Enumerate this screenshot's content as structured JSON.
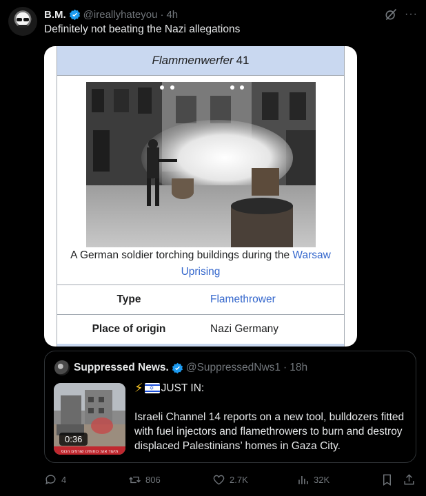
{
  "post": {
    "author_name": "B.M.",
    "handle": "@ireallyhateyou",
    "separator": "·",
    "time": "4h",
    "text": "Definitely not beating the Nazi allegations",
    "more": "···"
  },
  "wiki": {
    "title_italic": "Flammenwerfer",
    "title_num": "41",
    "caption_text": "A German soldier torching buildings during the ",
    "caption_link_1": "Warsaw",
    "caption_link_2": "Uprising",
    "rows": [
      {
        "key": "Type",
        "value": "Flamethrower"
      },
      {
        "key": "Place of origin",
        "value": "Nazi Germany"
      }
    ]
  },
  "quote": {
    "author_name": "Suppressed News.",
    "handle": "@SuppressedNws1",
    "separator": "·",
    "time": "18h",
    "video_duration": "0:36",
    "thumb_caption": "תיעוד אש: כוחותינו שורפים הכוס",
    "just_in": "JUST IN:",
    "text": "Israeli Channel 14 reports on a new tool, bulldozers fitted with fuel injectors and flamethrowers to burn and destroy displaced Palestinians’ homes in Gaza City."
  },
  "actions": {
    "replies": "4",
    "reposts": "806",
    "likes": "2.7K",
    "views": "32K"
  },
  "colors": {
    "background": "#000000",
    "text": "#e7e9ea",
    "muted": "#71767b",
    "verified": "#1d9bf0",
    "wiki_header": "#c9d8f0",
    "wiki_link": "#3366cc"
  }
}
